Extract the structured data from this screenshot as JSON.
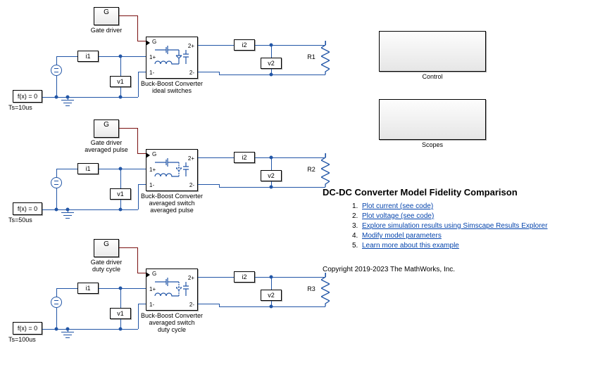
{
  "title": "DC-DC Converter Model Fidelity Comparison",
  "copyright": "Copyright 2019-2023 The MathWorks, Inc.",
  "right_panels": {
    "control": "Control",
    "scopes": "Scopes"
  },
  "links": {
    "1": "Plot current (see code)",
    "2": "Plot voltage (see code)",
    "3": "Explore simulation results using Simscape Results Explorer",
    "4": "Modify model parameters",
    "5": "Learn more about this example"
  },
  "list_numbers": {
    "1": "1.",
    "2": "2.",
    "3": "3.",
    "4": "4.",
    "5": "5."
  },
  "circuits": [
    {
      "gate_label": "G",
      "gate_caption": "Gate driver",
      "conv_caption": "Buck-Boost Converter\nideal switches",
      "i_in": "i1",
      "v_in": "v1",
      "i_out": "i2",
      "v_out": "v2",
      "r_label": "R1",
      "solver": "f(x) = 0",
      "ts": "Ts=10us",
      "ports": {
        "g": "G",
        "p1p": "1+",
        "p1m": "1-",
        "p2p": "2+",
        "p2m": "2-"
      }
    },
    {
      "gate_label": "G",
      "gate_caption": "Gate driver\naveraged pulse",
      "conv_caption": "Buck-Boost Converter\naveraged switch\naveraged pulse",
      "i_in": "i1",
      "v_in": "v1",
      "i_out": "i2",
      "v_out": "v2",
      "r_label": "R2",
      "solver": "f(x) = 0",
      "ts": "Ts=50us",
      "ports": {
        "g": "G",
        "p1p": "1+",
        "p1m": "1-",
        "p2p": "2+",
        "p2m": "2-"
      }
    },
    {
      "gate_label": "G",
      "gate_caption": "Gate driver\nduty cycle",
      "conv_caption": "Buck-Boost Converter\naveraged switch\nduty cycle",
      "i_in": "i1",
      "v_in": "v1",
      "i_out": "i2",
      "v_out": "v2",
      "r_label": "R3",
      "solver": "f(x) = 0",
      "ts": "Ts=100us",
      "ports": {
        "g": "G",
        "p1p": "1+",
        "p1m": "1-",
        "p2p": "2+",
        "p2m": "2-"
      }
    }
  ]
}
